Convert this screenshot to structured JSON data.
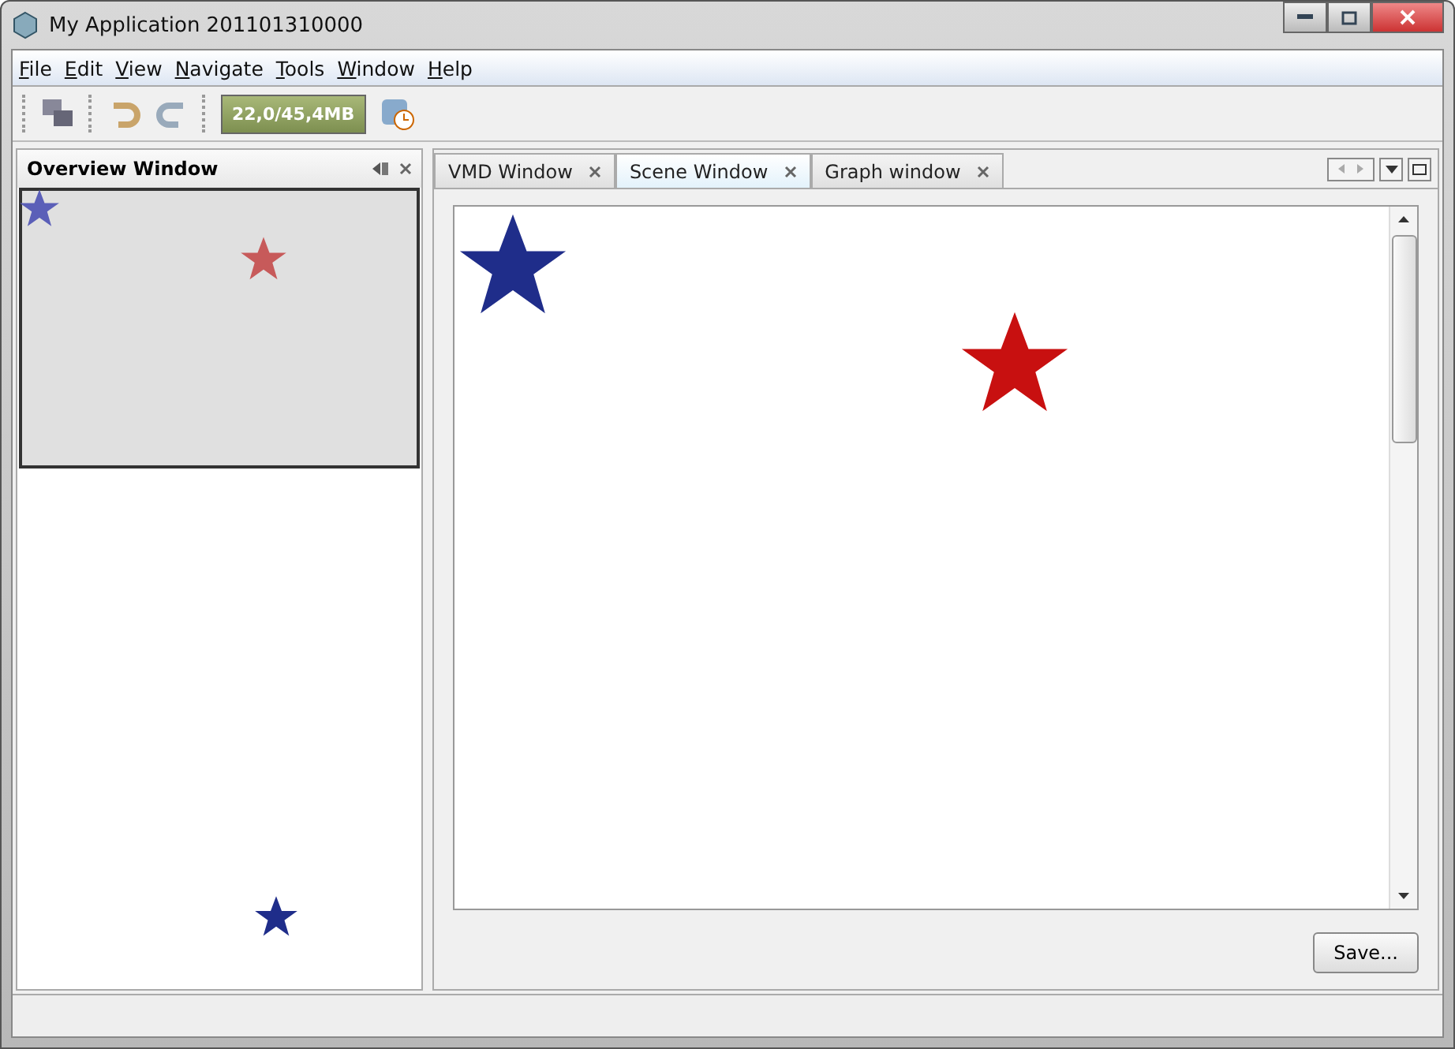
{
  "window": {
    "title": "My Application 201101310000"
  },
  "menu": [
    "File",
    "Edit",
    "View",
    "Navigate",
    "Tools",
    "Window",
    "Help"
  ],
  "toolbar": {
    "memory": "22,0/45,4MB"
  },
  "overview": {
    "title": "Overview Window"
  },
  "tabs": [
    {
      "label": "VMD Window",
      "selected": false
    },
    {
      "label": "Scene Window",
      "selected": true
    },
    {
      "label": "Graph window",
      "selected": false
    }
  ],
  "save_button": "Save..."
}
